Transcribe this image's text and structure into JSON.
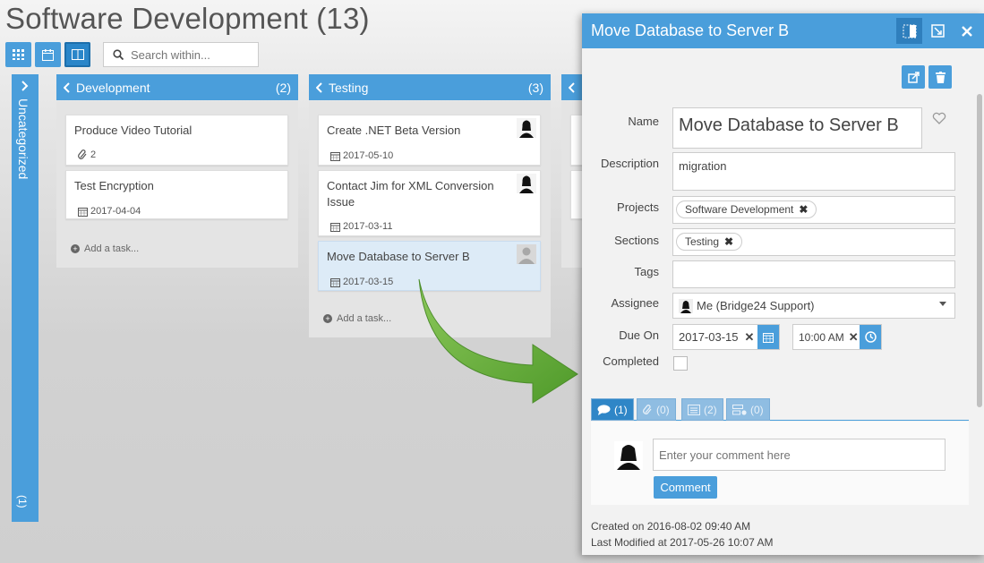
{
  "page": {
    "title": "Software Development (13)"
  },
  "toolbar": {
    "views": [
      {
        "name": "grid-view-icon"
      },
      {
        "name": "calendar-view-icon"
      },
      {
        "name": "board-view-icon",
        "active": true
      }
    ],
    "search_placeholder": "Search within..."
  },
  "uncategorized": {
    "label": "Uncategorized",
    "count": "(1)"
  },
  "columns": [
    {
      "name": "Development",
      "count": "(2)",
      "cards": [
        {
          "title": "Produce Video Tutorial",
          "meta": "2",
          "meta_icon": "paperclip-icon"
        },
        {
          "title": "Test Encryption",
          "meta": "2017-04-04",
          "meta_icon": "calendar-icon"
        }
      ],
      "add_task": "Add a task..."
    },
    {
      "name": "Testing",
      "count": "(3)",
      "cards": [
        {
          "title": "Create .NET Beta Version",
          "meta": "2017-05-10"
        },
        {
          "title": "Contact Jim for XML Conversion Issue",
          "meta": "2017-03-11"
        },
        {
          "title": "Move Database to Server B",
          "meta": "2017-03-15"
        }
      ],
      "add_task": "Add a task..."
    }
  ],
  "panel": {
    "title": "Move Database to Server B",
    "labels": {
      "name": "Name",
      "description": "Description",
      "projects": "Projects",
      "sections": "Sections",
      "tags": "Tags",
      "assignee": "Assignee",
      "due_on": "Due On",
      "completed": "Completed"
    },
    "name_value": "Move Database to Server B",
    "description_value": "migration",
    "project_chip": "Software Development",
    "section_chip": "Testing",
    "tags_value": "",
    "assignee_value": "Me (Bridge24 Support)",
    "due_date": "2017-03-15",
    "due_time": "10:00 AM",
    "completed": false,
    "tabs": [
      {
        "count": "(1)",
        "icon": "comment-icon"
      },
      {
        "count": "(0)",
        "icon": "paperclip-icon"
      },
      {
        "count": "(2)",
        "icon": "list-icon"
      },
      {
        "count": "(0)",
        "icon": "subtask-icon"
      }
    ],
    "comment_placeholder": "Enter your comment here",
    "comment_button": "Comment",
    "created_on": "Created on 2016-08-02 09:40 AM",
    "modified_at": "Last Modified at 2017-05-26 10:07 AM"
  },
  "colors": {
    "accent": "#4a9edb",
    "arrow": "#6db33f"
  }
}
